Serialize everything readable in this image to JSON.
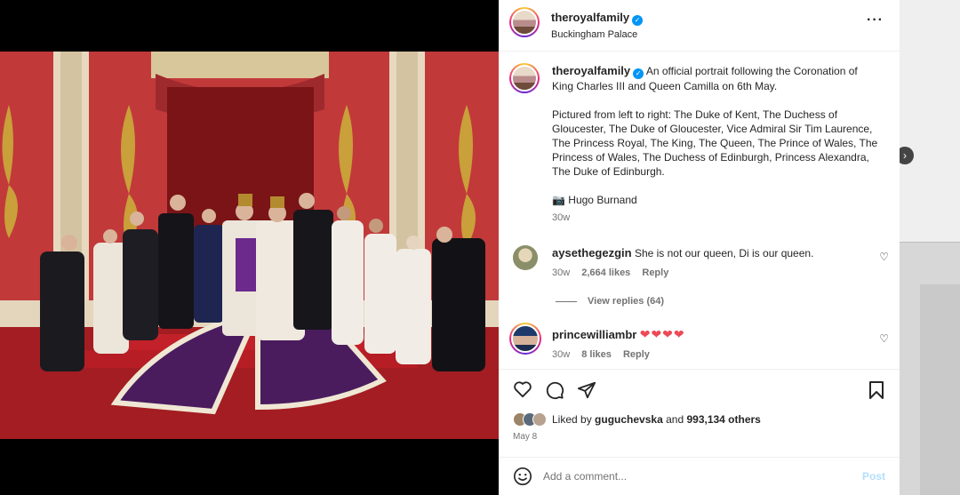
{
  "post": {
    "author": "theroyalfamily",
    "location": "Buckingham Palace",
    "caption_line1": "An official portrait following the Coronation of King Charles III and Queen Camilla on 6th May.",
    "caption_line2": "Pictured from left to right: The Duke of Kent, The Duchess of Gloucester, The Duke of Gloucester, Vice Admiral Sir Tim Laurence, The Princess Royal, The King, The Queen, The Prince of Wales, The Princess of Wales, The Duchess of Edinburgh, Princess Alexandra, The Duke of Edinburgh.",
    "caption_credit": "Hugo Burnand",
    "caption_time": "30w",
    "liked_by_prefix": "Liked by",
    "liked_by_user": "guguchevska",
    "liked_by_suffix": "and",
    "likes_count": "993,134 others",
    "date": "May 8"
  },
  "comments": [
    {
      "user": "aysethegezgin",
      "text": "She is not our queen, Di is our queen.",
      "time": "30w",
      "likes": "2,664 likes",
      "reply": "Reply",
      "view_replies": "View replies (64)"
    },
    {
      "user": "princewilliambr",
      "text": "❤❤❤❤",
      "time": "30w",
      "likes": "8 likes",
      "reply": "Reply"
    }
  ],
  "add_comment": {
    "placeholder": "Add a comment...",
    "post_label": "Post"
  },
  "icons": {
    "more": "more-options-icon",
    "like": "heart-icon",
    "comment": "comment-icon",
    "share": "share-icon",
    "save": "bookmark-icon",
    "emoji": "emoji-icon",
    "camera": "camera-emoji"
  },
  "colors": {
    "verified": "#0095f6",
    "heart": "#ed4956",
    "post_disabled": "#b2dffc",
    "muted": "#737373"
  }
}
